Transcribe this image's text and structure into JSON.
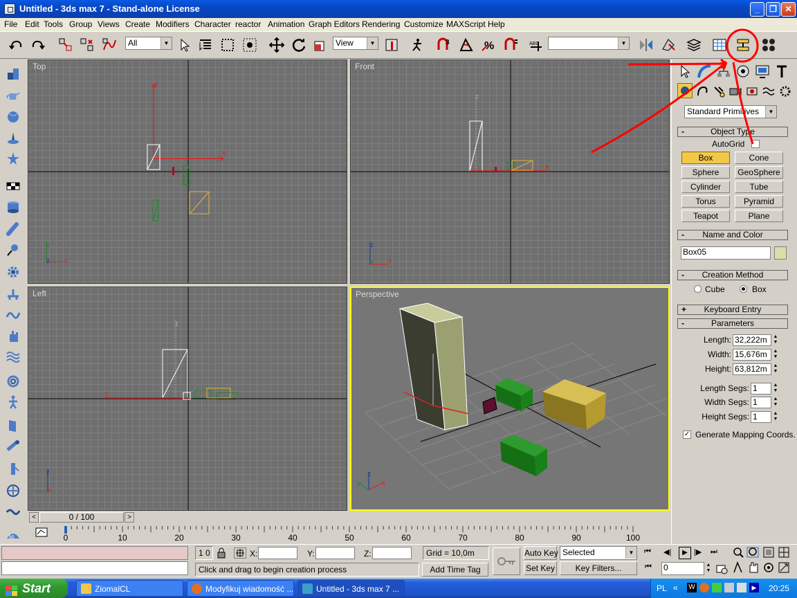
{
  "window": {
    "title": "Untitled - 3ds max 7  - Stand-alone License"
  },
  "menu": [
    "File",
    "Edit",
    "Tools",
    "Group",
    "Views",
    "Create",
    "Modifiers",
    "Character",
    "reactor",
    "Animation",
    "Graph Editors",
    "Rendering",
    "Customize",
    "MAXScript",
    "Help"
  ],
  "toolbar": {
    "selection_filter": "All",
    "ref_coord": "View",
    "named_selection": "",
    "icons": [
      "undo-icon",
      "redo-icon",
      "select-and-link-icon",
      "unlink-icon",
      "bind-space-warp-icon",
      "select-object-icon",
      "select-by-name-icon",
      "rectangular-selection-icon",
      "window-crossing-icon",
      "select-and-move-icon",
      "select-and-rotate-icon",
      "select-and-scale-icon",
      "use-pivot-point-icon",
      "select-manipulate-icon",
      "snap-toggle-icon",
      "angle-snap-icon",
      "percent-snap-icon",
      "spinner-snap-icon",
      "edit-named-selections-icon",
      "mirror-icon",
      "align-icon",
      "layer-manager-icon",
      "curve-editor-icon",
      "schematic-view-icon",
      "material-editor-icon"
    ]
  },
  "viewports": {
    "top_label": "Top",
    "front_label": "Front",
    "left_label": "Left",
    "perspective_label": "Perspective"
  },
  "command_panel": {
    "category": "Standard Primitives",
    "object_type": {
      "header": "Object Type",
      "autogrid": "AutoGrid",
      "buttons": [
        "Box",
        "Cone",
        "Sphere",
        "GeoSphere",
        "Cylinder",
        "Tube",
        "Torus",
        "Pyramid",
        "Teapot",
        "Plane"
      ],
      "active": "Box"
    },
    "name_and_color": {
      "header": "Name and Color",
      "name": "Box05",
      "color": "#d8e0a8"
    },
    "creation_method": {
      "header": "Creation Method",
      "options": [
        "Cube",
        "Box"
      ],
      "selected": "Box"
    },
    "keyboard_entry": {
      "header": "Keyboard Entry"
    },
    "parameters": {
      "header": "Parameters",
      "length_label": "Length:",
      "length": "32,222m",
      "width_label": "Width:",
      "width": "15,676m",
      "height_label": "Height:",
      "height": "63,812m",
      "length_segs_label": "Length Segs:",
      "length_segs": "1",
      "width_segs_label": "Width Segs:",
      "width_segs": "1",
      "height_segs_label": "Height Segs:",
      "height_segs": "1",
      "gen_mapping": "Generate Mapping Coords."
    }
  },
  "timeslider": {
    "label": "0 / 100",
    "ticks": [
      "0",
      "10",
      "20",
      "30",
      "40",
      "50",
      "60",
      "70",
      "80",
      "90",
      "100"
    ]
  },
  "status": {
    "selected_count": "1 0",
    "x_label": "X:",
    "y_label": "Y:",
    "z_label": "Z:",
    "grid": "Grid = 10,0m",
    "prompt": "Click and drag to begin creation process",
    "add_time_tag": "Add Time Tag",
    "auto_key": "Auto Key",
    "set_key": "Set Key",
    "key_mode": "Selected",
    "key_filters": "Key Filters...",
    "frame": "0"
  },
  "taskbar": {
    "start": "Start",
    "tasks": [
      "ZiomalCL",
      "Modyfikuj wiadomość ...",
      "Untitled - 3ds max 7 ..."
    ],
    "lang": "PL",
    "clock": "20:25"
  },
  "colors": {
    "annotation": "#ff0000",
    "viewport_active": "#ffff00",
    "box_button_active": "#f2c84a"
  }
}
